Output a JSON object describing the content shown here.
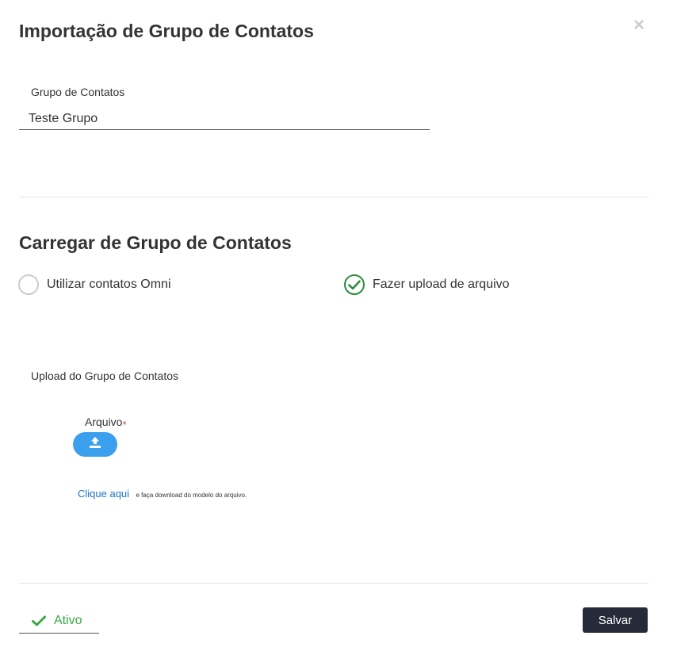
{
  "modal": {
    "title": "Importação de Grupo de Contatos",
    "close_glyph": "×"
  },
  "group_field": {
    "label": "Grupo de Contatos",
    "value": "Teste Grupo"
  },
  "load_section": {
    "title": "Carregar de Grupo de Contatos",
    "options": [
      {
        "label": "Utilizar contatos Omni",
        "selected": false
      },
      {
        "label": "Fazer upload de arquivo",
        "selected": true
      }
    ]
  },
  "upload": {
    "section_label": "Upload do Grupo de Contatos",
    "file_label": "Arquivo",
    "required_mark": "*",
    "download_link": "Clique aqui",
    "download_text": "e faça download do modelo do arquivo."
  },
  "footer": {
    "status_label": "Ativo",
    "save_label": "Salvar"
  },
  "colors": {
    "accent_green": "#2e8b3d",
    "upload_blue": "#3aa0ee",
    "link_blue": "#1a73c8",
    "save_dark": "#262b3a",
    "required_red": "#e53935"
  },
  "icons": {
    "close": "close-icon",
    "radio_checked": "check-circle-icon",
    "upload": "upload-icon",
    "status": "checkmark-icon"
  }
}
